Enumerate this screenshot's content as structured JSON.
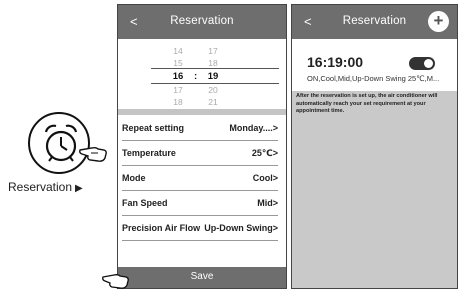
{
  "left_panel": {
    "label": "Reservation",
    "arrow": "▶"
  },
  "screen1": {
    "header": {
      "back": "<",
      "title": "Reservation"
    },
    "picker": {
      "rows": [
        {
          "hour": "14",
          "minute": "17"
        },
        {
          "hour": "15",
          "minute": "18"
        },
        {
          "hour": "16",
          "minute": "19"
        },
        {
          "hour": "17",
          "minute": "20"
        },
        {
          "hour": "18",
          "minute": "21"
        }
      ],
      "colon": ":"
    },
    "settings": [
      {
        "label": "Repeat setting",
        "value": "Monday....>"
      },
      {
        "label": "Temperature",
        "value": "25℃>"
      },
      {
        "label": "Mode",
        "value": "Cool>"
      },
      {
        "label": "Fan Speed",
        "value": "Mid>"
      },
      {
        "label": "Precision Air Flow",
        "value": "Up-Down Swing>"
      }
    ],
    "save_label": "Save"
  },
  "screen2": {
    "header": {
      "back": "<",
      "title": "Reservation",
      "add": "+"
    },
    "reservation": {
      "time": "16:19:00",
      "enabled": true,
      "detail": "ON,Cool,Mid,Up-Down Swing 25℃,M..."
    },
    "note": "After the reservation is set up, the air conditioner will automatically reach your set requirement at your appointment time."
  },
  "colors": {
    "header_bg": "#6e6e6e",
    "note_bg": "#c9c9c9",
    "text": "#222222"
  }
}
